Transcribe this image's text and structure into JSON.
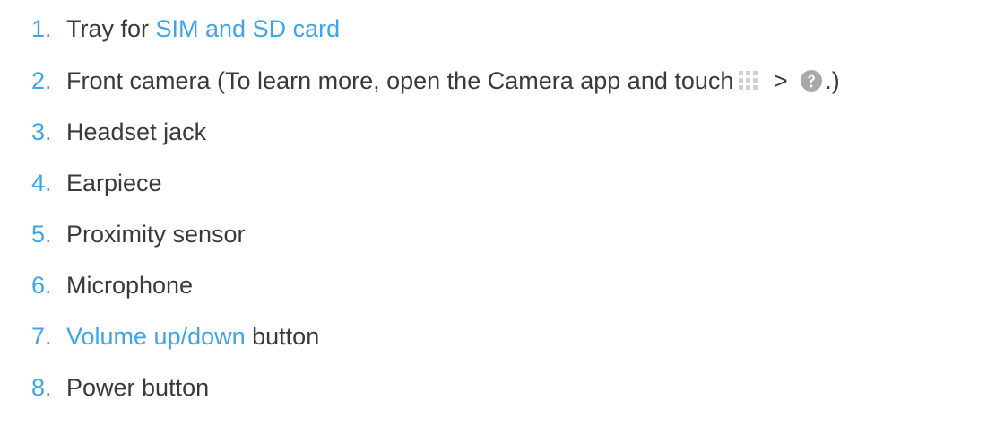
{
  "items": [
    {
      "number": "1.",
      "before": "Tray for ",
      "link": "SIM and SD card",
      "after": ""
    },
    {
      "number": "2.",
      "before": "Front camera (To learn more, open the Camera app and touch",
      "mid": ">",
      "after": ".)"
    },
    {
      "number": "3.",
      "text": "Headset jack"
    },
    {
      "number": "4.",
      "text": "Earpiece"
    },
    {
      "number": "5.",
      "text": "Proximity sensor"
    },
    {
      "number": "6.",
      "text": "Microphone"
    },
    {
      "number": "7.",
      "link": "Volume up/down",
      "after": " button"
    },
    {
      "number": "8.",
      "text": "Power button"
    }
  ],
  "icons": {
    "grid": "grid-menu-icon",
    "help": "help-icon",
    "grid_color": "#d0d0d0",
    "help_color": "#a8a8a8"
  },
  "colors": {
    "number": "#3ea5e8",
    "link": "#3ea5e8",
    "text": "#3a3a3a"
  }
}
